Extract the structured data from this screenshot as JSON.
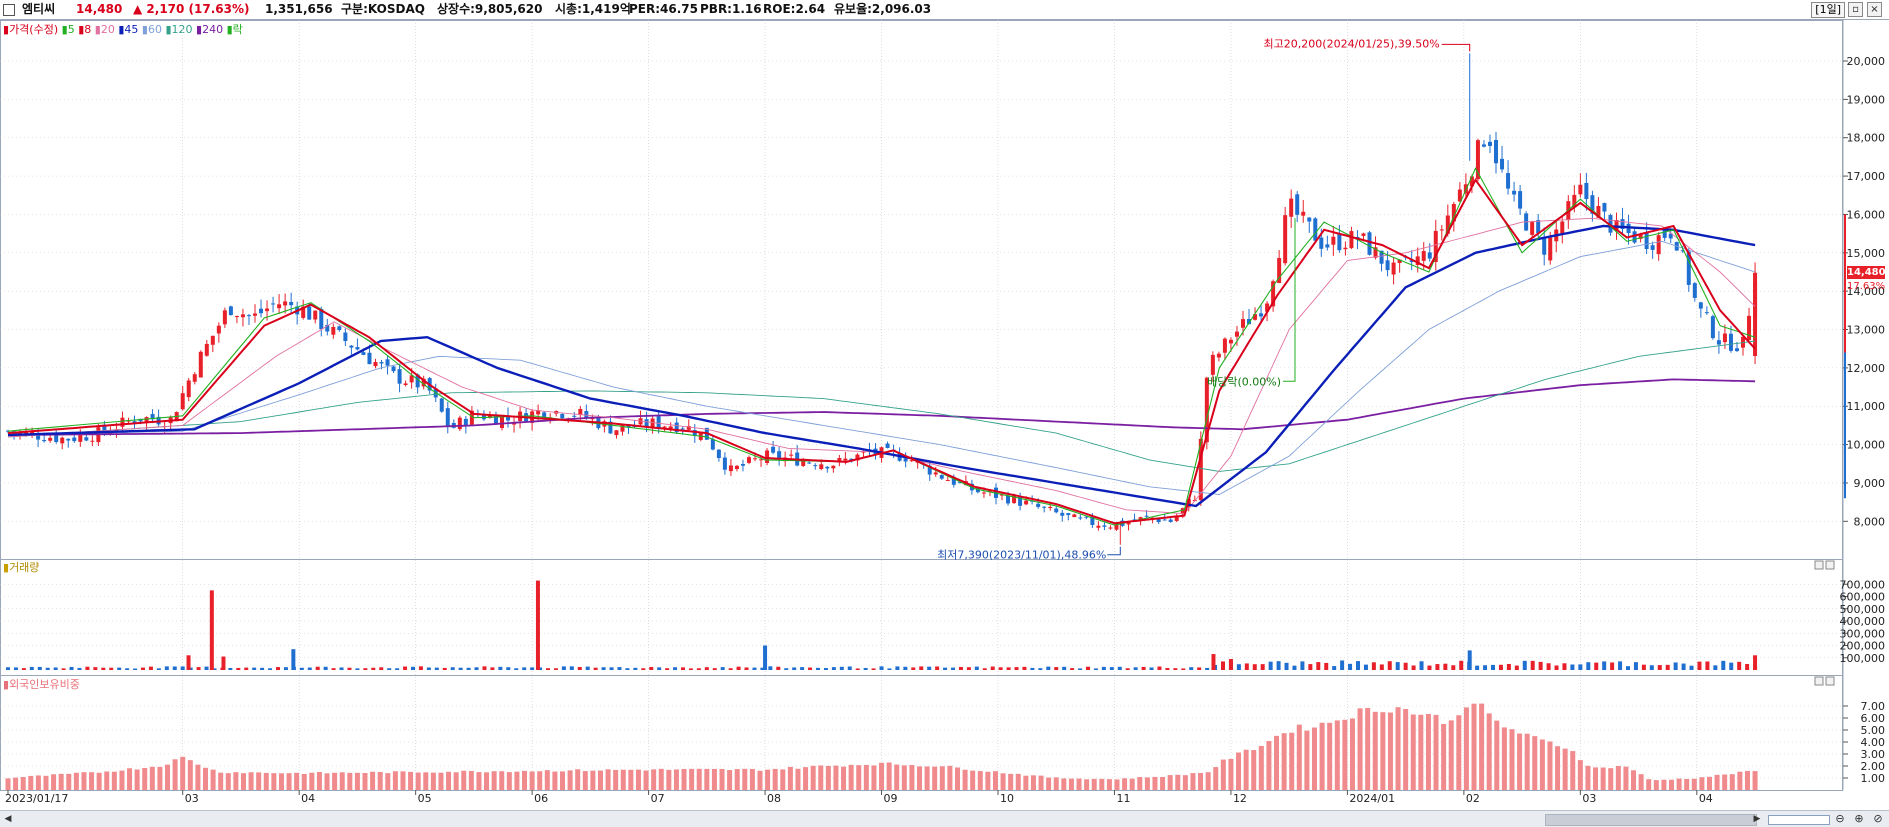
{
  "header": {
    "name": "엠티씨",
    "price": "14,480",
    "change": "▲ 2,170 (17.63%)",
    "volume": "1,351,656",
    "market": "구분:KOSDAQ",
    "shares": "상장수:9,805,620",
    "market_cap": "시총:1,419억",
    "per": "PER:46.75",
    "pbr": "PBR:1.16",
    "roe": "ROE:2.64",
    "float": "유보율:2,096.03",
    "period": "[1일]"
  },
  "legend": {
    "price": "가격(수정)",
    "ma": [
      {
        "label": "5",
        "color": "#21b021"
      },
      {
        "label": "8",
        "color": "#d9001b"
      },
      {
        "label": "20",
        "color": "#e070a0"
      },
      {
        "label": "45",
        "color": "#0b1fb8"
      },
      {
        "label": "60",
        "color": "#7fa0d8"
      },
      {
        "label": "120",
        "color": "#34a28a"
      },
      {
        "label": "240",
        "color": "#7b1fa2"
      }
    ],
    "rak": "락"
  },
  "volume_pane": {
    "title": "거래량"
  },
  "foreign_pane": {
    "title": "외국인보유비중"
  },
  "annotations": {
    "high": "최고20,200(2024/01/25),39.50%",
    "low": "최저7,390(2023/11/01),48.96%",
    "dividend": "배당락(0.00%)",
    "price_tag": "14,480",
    "pct_tag": "17.63%"
  },
  "colors": {
    "up": "#e8202a",
    "down": "#1f6fd1",
    "foreign_bar": "#f08a8c",
    "grid": "#c8c8c8"
  },
  "chart_data": [
    {
      "type": "candlestick",
      "title": "엠티씨",
      "ylim": [
        7200,
        20600
      ],
      "yticks": [
        8000,
        9000,
        10000,
        11000,
        12000,
        13000,
        14000,
        15000,
        16000,
        17000,
        18000,
        19000,
        20000
      ],
      "ytick_labels": [
        "8,000",
        "9,000",
        "10,000",
        "11,000",
        "12,000",
        "13,000",
        "14,000",
        "15,000",
        "16,000",
        "17,000",
        "18,000",
        "19,000",
        "20,000"
      ],
      "x_labels": [
        {
          "label": "2023/01/17",
          "month": 0
        },
        {
          "label": "03",
          "month": 1.5
        },
        {
          "label": "04",
          "month": 2.5
        },
        {
          "label": "05",
          "month": 3.5
        },
        {
          "label": "06",
          "month": 4.5
        },
        {
          "label": "07",
          "month": 5.5
        },
        {
          "label": "08",
          "month": 6.5
        },
        {
          "label": "09",
          "month": 7.5
        },
        {
          "label": "10",
          "month": 8.5
        },
        {
          "label": "11",
          "month": 9.5
        },
        {
          "label": "12",
          "month": 10.5
        },
        {
          "label": "2024/01",
          "month": 11.5
        },
        {
          "label": "02",
          "month": 12.5
        },
        {
          "label": "03",
          "month": 13.5
        },
        {
          "label": "04",
          "month": 14.5
        }
      ],
      "close_path": [
        [
          0,
          10350
        ],
        [
          0.5,
          10150
        ],
        [
          0.8,
          10300
        ],
        [
          1.1,
          10700
        ],
        [
          1.4,
          10650
        ],
        [
          1.6,
          12000
        ],
        [
          1.9,
          13600
        ],
        [
          2.1,
          13300
        ],
        [
          2.3,
          13700
        ],
        [
          2.5,
          13600
        ],
        [
          2.8,
          12900
        ],
        [
          3.0,
          12500
        ],
        [
          3.3,
          11800
        ],
        [
          3.6,
          11500
        ],
        [
          3.8,
          10400
        ],
        [
          4.0,
          10800
        ],
        [
          4.3,
          10650
        ],
        [
          4.6,
          10900
        ],
        [
          4.9,
          10800
        ],
        [
          5.2,
          10400
        ],
        [
          5.5,
          10550
        ],
        [
          5.8,
          10500
        ],
        [
          6.0,
          10200
        ],
        [
          6.2,
          9300
        ],
        [
          6.5,
          9700
        ],
        [
          6.8,
          9600
        ],
        [
          7.1,
          9500
        ],
        [
          7.4,
          9800
        ],
        [
          7.7,
          9700
        ],
        [
          8.0,
          9200
        ],
        [
          8.3,
          8800
        ],
        [
          8.6,
          8600
        ],
        [
          8.9,
          8300
        ],
        [
          9.2,
          8000
        ],
        [
          9.5,
          7900
        ],
        [
          9.8,
          8100
        ],
        [
          10.0,
          8000
        ],
        [
          10.2,
          8700
        ],
        [
          10.3,
          12000
        ],
        [
          10.5,
          12800
        ],
        [
          10.8,
          13700
        ],
        [
          11.0,
          16200
        ],
        [
          11.3,
          15200
        ],
        [
          11.6,
          15400
        ],
        [
          11.9,
          14500
        ],
        [
          12.2,
          15000
        ],
        [
          12.5,
          16800
        ],
        [
          12.7,
          18200
        ],
        [
          12.9,
          16400
        ],
        [
          13.2,
          15100
        ],
        [
          13.5,
          16600
        ],
        [
          13.8,
          15600
        ],
        [
          14.1,
          15300
        ],
        [
          14.3,
          15600
        ],
        [
          14.5,
          13600
        ],
        [
          14.7,
          12700
        ],
        [
          14.9,
          12600
        ],
        [
          15.0,
          14480
        ]
      ],
      "ma_paths": {
        "8": [
          [
            0,
            10300
          ],
          [
            1.5,
            10650
          ],
          [
            2.2,
            13100
          ],
          [
            2.6,
            13650
          ],
          [
            3.1,
            12800
          ],
          [
            3.6,
            11600
          ],
          [
            4.0,
            10800
          ],
          [
            4.5,
            10700
          ],
          [
            5.2,
            10550
          ],
          [
            6.0,
            10300
          ],
          [
            6.5,
            9650
          ],
          [
            7.2,
            9550
          ],
          [
            7.6,
            9850
          ],
          [
            8.3,
            8900
          ],
          [
            9.0,
            8450
          ],
          [
            9.5,
            7950
          ],
          [
            10.1,
            8150
          ],
          [
            10.4,
            11400
          ],
          [
            10.9,
            13900
          ],
          [
            11.3,
            15600
          ],
          [
            11.8,
            15200
          ],
          [
            12.2,
            14600
          ],
          [
            12.6,
            16900
          ],
          [
            13.0,
            15200
          ],
          [
            13.5,
            16300
          ],
          [
            13.9,
            15400
          ],
          [
            14.3,
            15700
          ],
          [
            14.7,
            13500
          ],
          [
            15.0,
            12500
          ]
        ],
        "5": [
          [
            0,
            10350
          ],
          [
            1.5,
            10750
          ],
          [
            2.2,
            13300
          ],
          [
            2.6,
            13700
          ],
          [
            3.1,
            12700
          ],
          [
            3.6,
            11500
          ],
          [
            4.0,
            10700
          ],
          [
            4.5,
            10750
          ],
          [
            5.2,
            10500
          ],
          [
            6.0,
            10200
          ],
          [
            6.5,
            9600
          ],
          [
            7.2,
            9550
          ],
          [
            7.6,
            9850
          ],
          [
            8.3,
            8850
          ],
          [
            9.0,
            8400
          ],
          [
            9.5,
            7900
          ],
          [
            10.1,
            8300
          ],
          [
            10.4,
            12000
          ],
          [
            10.9,
            14300
          ],
          [
            11.3,
            15800
          ],
          [
            11.8,
            15000
          ],
          [
            12.2,
            14500
          ],
          [
            12.6,
            17200
          ],
          [
            13.0,
            15000
          ],
          [
            13.5,
            16400
          ],
          [
            13.9,
            15300
          ],
          [
            14.3,
            15600
          ],
          [
            14.7,
            13100
          ],
          [
            15.0,
            12800
          ]
        ],
        "20": [
          [
            0,
            10200
          ],
          [
            1.5,
            10500
          ],
          [
            2.3,
            12300
          ],
          [
            2.8,
            13200
          ],
          [
            3.3,
            12400
          ],
          [
            3.9,
            11500
          ],
          [
            4.5,
            10900
          ],
          [
            5.2,
            10700
          ],
          [
            6.0,
            10400
          ],
          [
            6.7,
            9900
          ],
          [
            7.5,
            9800
          ],
          [
            8.2,
            9300
          ],
          [
            9.0,
            8800
          ],
          [
            9.6,
            8300
          ],
          [
            10.1,
            8200
          ],
          [
            10.5,
            9700
          ],
          [
            11.0,
            13000
          ],
          [
            11.5,
            14800
          ],
          [
            12.0,
            15000
          ],
          [
            12.5,
            15400
          ],
          [
            13.0,
            15800
          ],
          [
            13.6,
            15900
          ],
          [
            14.2,
            15700
          ],
          [
            14.7,
            14500
          ],
          [
            15.0,
            13600
          ]
        ],
        "45": [
          [
            0,
            10250
          ],
          [
            1.6,
            10400
          ],
          [
            2.5,
            11600
          ],
          [
            3.2,
            12700
          ],
          [
            3.6,
            12800
          ],
          [
            4.2,
            12000
          ],
          [
            5.0,
            11200
          ],
          [
            5.8,
            10750
          ],
          [
            6.5,
            10300
          ],
          [
            7.3,
            9900
          ],
          [
            8.2,
            9400
          ],
          [
            9.0,
            9000
          ],
          [
            9.8,
            8600
          ],
          [
            10.2,
            8400
          ],
          [
            10.8,
            9800
          ],
          [
            11.4,
            12000
          ],
          [
            12.0,
            14100
          ],
          [
            12.6,
            15000
          ],
          [
            13.2,
            15400
          ],
          [
            13.7,
            15700
          ],
          [
            14.3,
            15600
          ],
          [
            15.0,
            15200
          ]
        ],
        "60": [
          [
            0,
            10250
          ],
          [
            1.5,
            10350
          ],
          [
            2.5,
            11300
          ],
          [
            3.2,
            12000
          ],
          [
            3.7,
            12300
          ],
          [
            4.4,
            12200
          ],
          [
            5.2,
            11500
          ],
          [
            6.0,
            11000
          ],
          [
            7.0,
            10500
          ],
          [
            8.0,
            10000
          ],
          [
            9.0,
            9400
          ],
          [
            9.8,
            8900
          ],
          [
            10.4,
            8700
          ],
          [
            11.0,
            9700
          ],
          [
            11.6,
            11400
          ],
          [
            12.2,
            13000
          ],
          [
            12.8,
            14000
          ],
          [
            13.5,
            14900
          ],
          [
            14.2,
            15300
          ],
          [
            15.0,
            14500
          ]
        ],
        "120": [
          [
            0,
            10200
          ],
          [
            2.0,
            10600
          ],
          [
            3.0,
            11100
          ],
          [
            3.8,
            11350
          ],
          [
            5.0,
            11400
          ],
          [
            6.0,
            11350
          ],
          [
            7.0,
            11200
          ],
          [
            8.0,
            10800
          ],
          [
            9.0,
            10300
          ],
          [
            9.8,
            9600
          ],
          [
            10.4,
            9300
          ],
          [
            11.0,
            9500
          ],
          [
            11.8,
            10300
          ],
          [
            12.5,
            11000
          ],
          [
            13.2,
            11700
          ],
          [
            14.0,
            12300
          ],
          [
            15.0,
            12700
          ]
        ],
        "240": [
          [
            0,
            10250
          ],
          [
            2.0,
            10300
          ],
          [
            3.0,
            10400
          ],
          [
            4.0,
            10500
          ],
          [
            5.0,
            10700
          ],
          [
            6.0,
            10800
          ],
          [
            7.0,
            10850
          ],
          [
            8.0,
            10750
          ],
          [
            9.0,
            10600
          ],
          [
            10.0,
            10450
          ],
          [
            10.6,
            10400
          ],
          [
            11.5,
            10650
          ],
          [
            12.5,
            11200
          ],
          [
            13.5,
            11550
          ],
          [
            14.3,
            11700
          ],
          [
            15.0,
            11650
          ]
        ]
      },
      "high": {
        "value": 20200,
        "date": "2024/01/25",
        "month": 12.55
      },
      "low": {
        "value": 7390,
        "date": "2023/11/01",
        "month": 9.55
      }
    },
    {
      "type": "bar",
      "title": "거래량",
      "ylim": [
        0,
        800000
      ],
      "yticks": [
        100000,
        200000,
        300000,
        400000,
        500000,
        600000,
        700000
      ],
      "ytick_labels": [
        "100,000",
        "200,000",
        "300,000",
        "400,000",
        "500,000",
        "600,000",
        "700,000"
      ],
      "spikes": [
        [
          1.55,
          120000,
          "up"
        ],
        [
          1.75,
          650000,
          "up"
        ],
        [
          1.85,
          110000,
          "up"
        ],
        [
          2.45,
          170000,
          "down"
        ],
        [
          4.55,
          730000,
          "up"
        ],
        [
          6.5,
          200000,
          "down"
        ],
        [
          10.35,
          130000,
          "up"
        ],
        [
          10.5,
          90000,
          "up"
        ],
        [
          12.55,
          160000,
          "down"
        ],
        [
          15.0,
          120000,
          "up"
        ]
      ]
    },
    {
      "type": "bar",
      "title": "외국인보유비중",
      "ylim": [
        0,
        8.5
      ],
      "yticks": [
        1,
        2,
        3,
        4,
        5,
        6,
        7
      ],
      "ytick_labels": [
        "1.00",
        "2.00",
        "3.00",
        "4.00",
        "5.00",
        "6.00",
        "7.00"
      ],
      "points": [
        [
          0,
          1.0
        ],
        [
          0.8,
          1.5
        ],
        [
          1.3,
          2.0
        ],
        [
          1.5,
          2.7
        ],
        [
          1.8,
          1.5
        ],
        [
          2.5,
          1.4
        ],
        [
          3.5,
          1.5
        ],
        [
          4.5,
          1.6
        ],
        [
          5.5,
          1.7
        ],
        [
          6.5,
          1.7
        ],
        [
          7.0,
          2.0
        ],
        [
          7.5,
          2.2
        ],
        [
          8.0,
          2.0
        ],
        [
          8.5,
          1.5
        ],
        [
          9.0,
          1.0
        ],
        [
          9.5,
          0.9
        ],
        [
          10.0,
          1.2
        ],
        [
          10.3,
          1.5
        ],
        [
          10.45,
          2.5
        ],
        [
          10.7,
          3.5
        ],
        [
          11.0,
          5.0
        ],
        [
          11.3,
          5.5
        ],
        [
          11.6,
          6.5
        ],
        [
          11.9,
          6.9
        ],
        [
          12.2,
          6.2
        ],
        [
          12.4,
          5.6
        ],
        [
          12.55,
          7.7
        ],
        [
          12.8,
          5.5
        ],
        [
          13.1,
          4.3
        ],
        [
          13.4,
          3.5
        ],
        [
          13.6,
          1.8
        ],
        [
          13.9,
          2.0
        ],
        [
          14.1,
          0.8
        ],
        [
          14.5,
          1.0
        ],
        [
          15.0,
          1.6
        ]
      ]
    }
  ]
}
